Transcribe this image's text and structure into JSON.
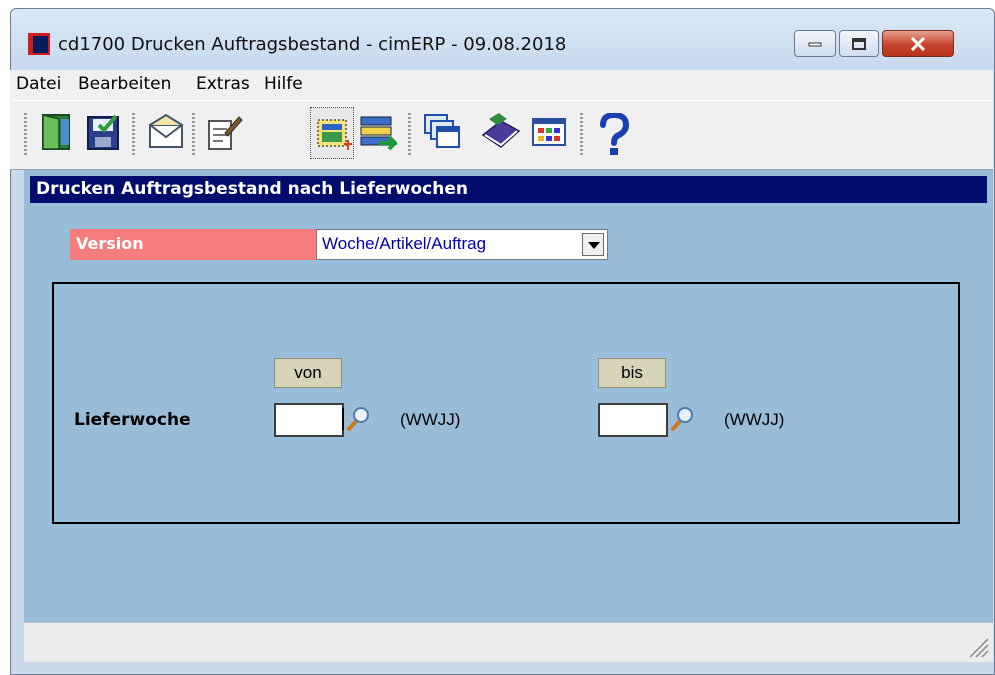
{
  "window": {
    "title": "cd1700 Drucken Auftragsbestand - cimERP - 09.08.2018"
  },
  "menu": {
    "items": [
      "Datei",
      "Bearbeiten",
      "Extras",
      "Hilfe"
    ]
  },
  "toolbar": {
    "icons": [
      "exit-door-icon",
      "save-icon",
      "mail-icon",
      "edit-document-icon",
      "new-record-icon",
      "transfer-list-icon",
      "windows-icon",
      "book-icon",
      "grid-table-icon",
      "help-icon"
    ]
  },
  "section": {
    "header": "Drucken Auftragsbestand nach Lieferwochen"
  },
  "version": {
    "label": "Version",
    "selected": "Woche/Artikel/Auftrag"
  },
  "filter": {
    "row_label": "Lieferwoche",
    "from_label": "von",
    "to_label": "bis",
    "from_value": "",
    "to_value": "",
    "format_hint": "(WWJJ)"
  },
  "colors": {
    "header_bg": "#000b6e",
    "panel_bg": "#99bdd9",
    "version_label_bg": "#f47c7c",
    "select_text": "#0000b0"
  }
}
